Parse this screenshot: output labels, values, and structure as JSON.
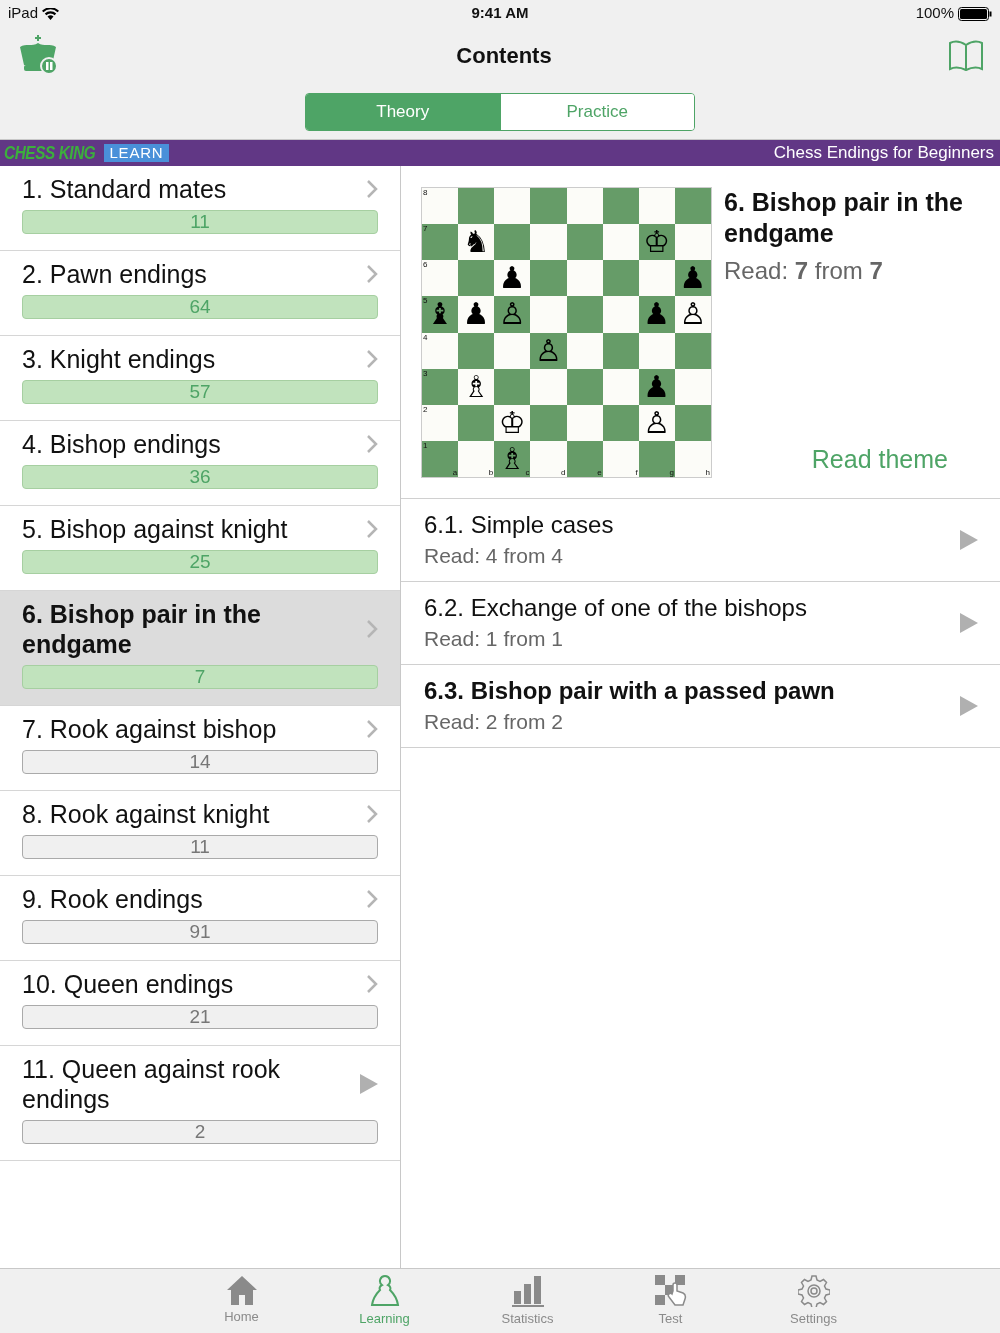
{
  "status_bar": {
    "device": "iPad",
    "time": "9:41 AM",
    "battery": "100%"
  },
  "nav": {
    "title": "Contents"
  },
  "segments": [
    {
      "label": "Theory",
      "selected": true
    },
    {
      "label": "Practice",
      "selected": false
    }
  ],
  "banner": {
    "logo_text": "CHESS KING",
    "logo_badge": "LEARN",
    "course": "Chess Endings for Beginners"
  },
  "chapters": [
    {
      "title": "1. Standard mates",
      "count": "11",
      "completed": true,
      "selected": false,
      "kind": "chevron"
    },
    {
      "title": "2. Pawn endings",
      "count": "64",
      "completed": true,
      "selected": false,
      "kind": "chevron"
    },
    {
      "title": "3. Knight endings",
      "count": "57",
      "completed": true,
      "selected": false,
      "kind": "chevron"
    },
    {
      "title": "4. Bishop endings",
      "count": "36",
      "completed": true,
      "selected": false,
      "kind": "chevron"
    },
    {
      "title": "5. Bishop against knight",
      "count": "25",
      "completed": true,
      "selected": false,
      "kind": "chevron"
    },
    {
      "title": "6. Bishop pair in the endgame",
      "count": "7",
      "completed": true,
      "selected": true,
      "kind": "chevron"
    },
    {
      "title": "7. Rook against bishop",
      "count": "14",
      "completed": false,
      "selected": false,
      "kind": "chevron"
    },
    {
      "title": "8. Rook against knight",
      "count": "11",
      "completed": false,
      "selected": false,
      "kind": "chevron"
    },
    {
      "title": "9. Rook endings",
      "count": "91",
      "completed": false,
      "selected": false,
      "kind": "chevron"
    },
    {
      "title": "10. Queen endings",
      "count": "21",
      "completed": false,
      "selected": false,
      "kind": "chevron"
    },
    {
      "title": "11. Queen against rook endings",
      "count": "2",
      "completed": false,
      "selected": false,
      "kind": "play"
    }
  ],
  "detail": {
    "title": "6. Bishop pair in the endgame",
    "read": "Read: **7** from **7**",
    "link": "Read theme",
    "board": {
      "ranks": [
        "8",
        "7",
        "6",
        "5",
        "4",
        "3",
        "2",
        "1"
      ],
      "files": [
        "a",
        "b",
        "c",
        "d",
        "e",
        "f",
        "g",
        "h"
      ],
      "squares": [
        [
          {
            "kind": "empty"
          },
          {
            "kind": "empty"
          },
          {
            "kind": "empty"
          },
          {
            "kind": "empty"
          },
          {
            "kind": "empty"
          },
          {
            "kind": "empty"
          },
          {
            "kind": "empty"
          },
          {
            "kind": "empty"
          }
        ],
        [
          {
            "kind": "empty"
          },
          {
            "kind": "piece",
            "piece": "♞"
          },
          {
            "kind": "empty"
          },
          {
            "kind": "empty"
          },
          {
            "kind": "empty"
          },
          {
            "kind": "empty"
          },
          {
            "kind": "piece",
            "piece": "♔"
          },
          {
            "kind": "empty"
          }
        ],
        [
          {
            "kind": "empty"
          },
          {
            "kind": "empty"
          },
          {
            "kind": "piece",
            "piece": "♟"
          },
          {
            "kind": "empty"
          },
          {
            "kind": "empty"
          },
          {
            "kind": "empty"
          },
          {
            "kind": "empty"
          },
          {
            "kind": "piece",
            "piece": "♟"
          }
        ],
        [
          {
            "kind": "piece",
            "piece": "♝"
          },
          {
            "kind": "piece",
            "piece": "♟"
          },
          {
            "kind": "piece",
            "piece": "♙"
          },
          {
            "kind": "empty"
          },
          {
            "kind": "empty"
          },
          {
            "kind": "empty"
          },
          {
            "kind": "piece",
            "piece": "♟"
          },
          {
            "kind": "piece",
            "piece": "♙"
          }
        ],
        [
          {
            "kind": "empty"
          },
          {
            "kind": "empty"
          },
          {
            "kind": "empty"
          },
          {
            "kind": "piece",
            "piece": "♙"
          },
          {
            "kind": "empty"
          },
          {
            "kind": "empty"
          },
          {
            "kind": "empty"
          },
          {
            "kind": "empty"
          }
        ],
        [
          {
            "kind": "empty"
          },
          {
            "kind": "piece",
            "piece": "♗"
          },
          {
            "kind": "empty"
          },
          {
            "kind": "empty"
          },
          {
            "kind": "empty"
          },
          {
            "kind": "empty"
          },
          {
            "kind": "piece",
            "piece": "♟"
          },
          {
            "kind": "empty"
          }
        ],
        [
          {
            "kind": "empty"
          },
          {
            "kind": "empty"
          },
          {
            "kind": "piece",
            "piece": "♔"
          },
          {
            "kind": "empty"
          },
          {
            "kind": "empty"
          },
          {
            "kind": "empty"
          },
          {
            "kind": "piece",
            "piece": "♙"
          },
          {
            "kind": "empty"
          }
        ],
        [
          {
            "kind": "empty"
          },
          {
            "kind": "empty"
          },
          {
            "kind": "piece",
            "piece": "♗"
          },
          {
            "kind": "empty"
          },
          {
            "kind": "empty"
          },
          {
            "kind": "empty"
          },
          {
            "kind": "empty"
          },
          {
            "kind": "empty"
          }
        ]
      ]
    },
    "sections": [
      {
        "title": "6.1. Simple cases",
        "read": "Read: 4 from 4",
        "current": false
      },
      {
        "title": "6.2. Exchange of one of the bishops",
        "read": "Read: 1 from 1",
        "current": false
      },
      {
        "title": "6.3. Bishop pair with a passed pawn",
        "read": "Read: 2 from 2",
        "current": true
      }
    ]
  },
  "tabs": [
    {
      "label": "Home",
      "selected": false,
      "kind": "home"
    },
    {
      "label": "Learning",
      "selected": true,
      "kind": "learning"
    },
    {
      "label": "Statistics",
      "selected": false,
      "kind": "statistics"
    },
    {
      "label": "Test",
      "selected": false,
      "kind": "test"
    },
    {
      "label": "Settings",
      "selected": false,
      "kind": "settings"
    }
  ]
}
